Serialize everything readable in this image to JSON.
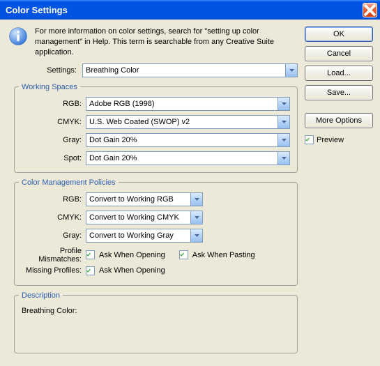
{
  "window": {
    "title": "Color Settings"
  },
  "info_text": "For more information on color settings, search for \"setting up color management\" in Help. This term is searchable from any Creative Suite application.",
  "settings": {
    "label": "Settings:",
    "value": "Breathing Color"
  },
  "working_spaces": {
    "legend": "Working Spaces",
    "rgb_label": "RGB:",
    "rgb_value": "Adobe RGB (1998)",
    "cmyk_label": "CMYK:",
    "cmyk_value": "U.S. Web Coated (SWOP) v2",
    "gray_label": "Gray:",
    "gray_value": "Dot Gain 20%",
    "spot_label": "Spot:",
    "spot_value": "Dot Gain 20%"
  },
  "policies": {
    "legend": "Color Management Policies",
    "rgb_label": "RGB:",
    "rgb_value": "Convert to Working RGB",
    "cmyk_label": "CMYK:",
    "cmyk_value": "Convert to Working CMYK",
    "gray_label": "Gray:",
    "gray_value": "Convert to Working Gray",
    "mismatch_label": "Profile Mismatches:",
    "mismatch_open": "Ask When Opening",
    "mismatch_paste": "Ask When Pasting",
    "missing_label": "Missing Profiles:",
    "missing_open": "Ask When Opening"
  },
  "description": {
    "legend": "Description",
    "text": "Breathing Color:"
  },
  "buttons": {
    "ok": "OK",
    "cancel": "Cancel",
    "load": "Load...",
    "save": "Save...",
    "more": "More Options",
    "preview": "Preview"
  }
}
